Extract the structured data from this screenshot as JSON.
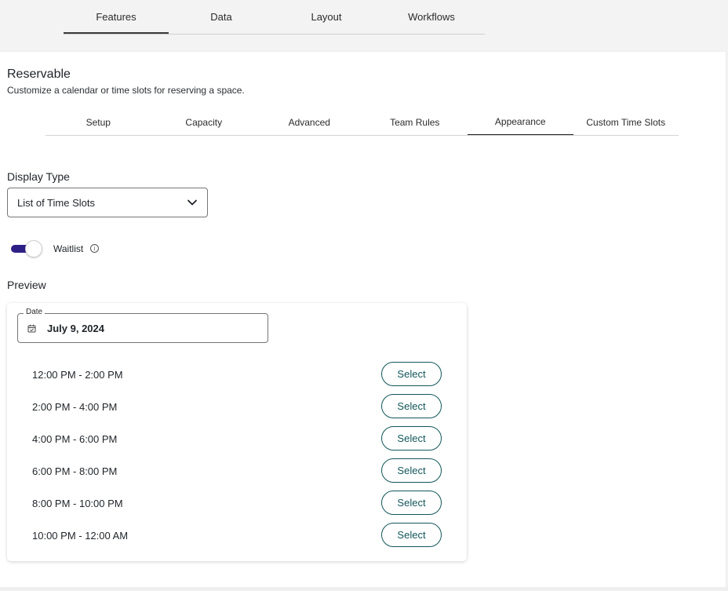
{
  "top_tabs": [
    {
      "label": "Features",
      "active": true
    },
    {
      "label": "Data",
      "active": false
    },
    {
      "label": "Layout",
      "active": false
    },
    {
      "label": "Workflows",
      "active": false
    }
  ],
  "section": {
    "title": "Reservable",
    "subtitle": "Customize a calendar or time slots for reserving a space."
  },
  "sub_tabs": [
    {
      "label": "Setup",
      "active": false
    },
    {
      "label": "Capacity",
      "active": false
    },
    {
      "label": "Advanced",
      "active": false
    },
    {
      "label": "Team Rules",
      "active": false
    },
    {
      "label": "Appearance",
      "active": true
    },
    {
      "label": "Custom Time Slots",
      "active": false
    }
  ],
  "display_type": {
    "label": "Display Type",
    "value": "List of Time Slots",
    "icon": "chevron-down-icon"
  },
  "waitlist": {
    "label": "Waitlist",
    "enabled": true,
    "toggle_color": "#2d1f86",
    "info_icon": "info-icon"
  },
  "preview": {
    "label": "Preview",
    "date": {
      "legend": "Date",
      "value": "July 9, 2024",
      "icon": "calendar-icon"
    },
    "slots": [
      {
        "time": "12:00 PM - 2:00 PM",
        "action": "Select"
      },
      {
        "time": "2:00 PM - 4:00 PM",
        "action": "Select"
      },
      {
        "time": "4:00 PM - 6:00 PM",
        "action": "Select"
      },
      {
        "time": "6:00 PM - 8:00 PM",
        "action": "Select"
      },
      {
        "time": "8:00 PM - 10:00 PM",
        "action": "Select"
      },
      {
        "time": "10:00 PM - 12:00 AM",
        "action": "Select"
      }
    ],
    "button_color": "#12565a"
  }
}
